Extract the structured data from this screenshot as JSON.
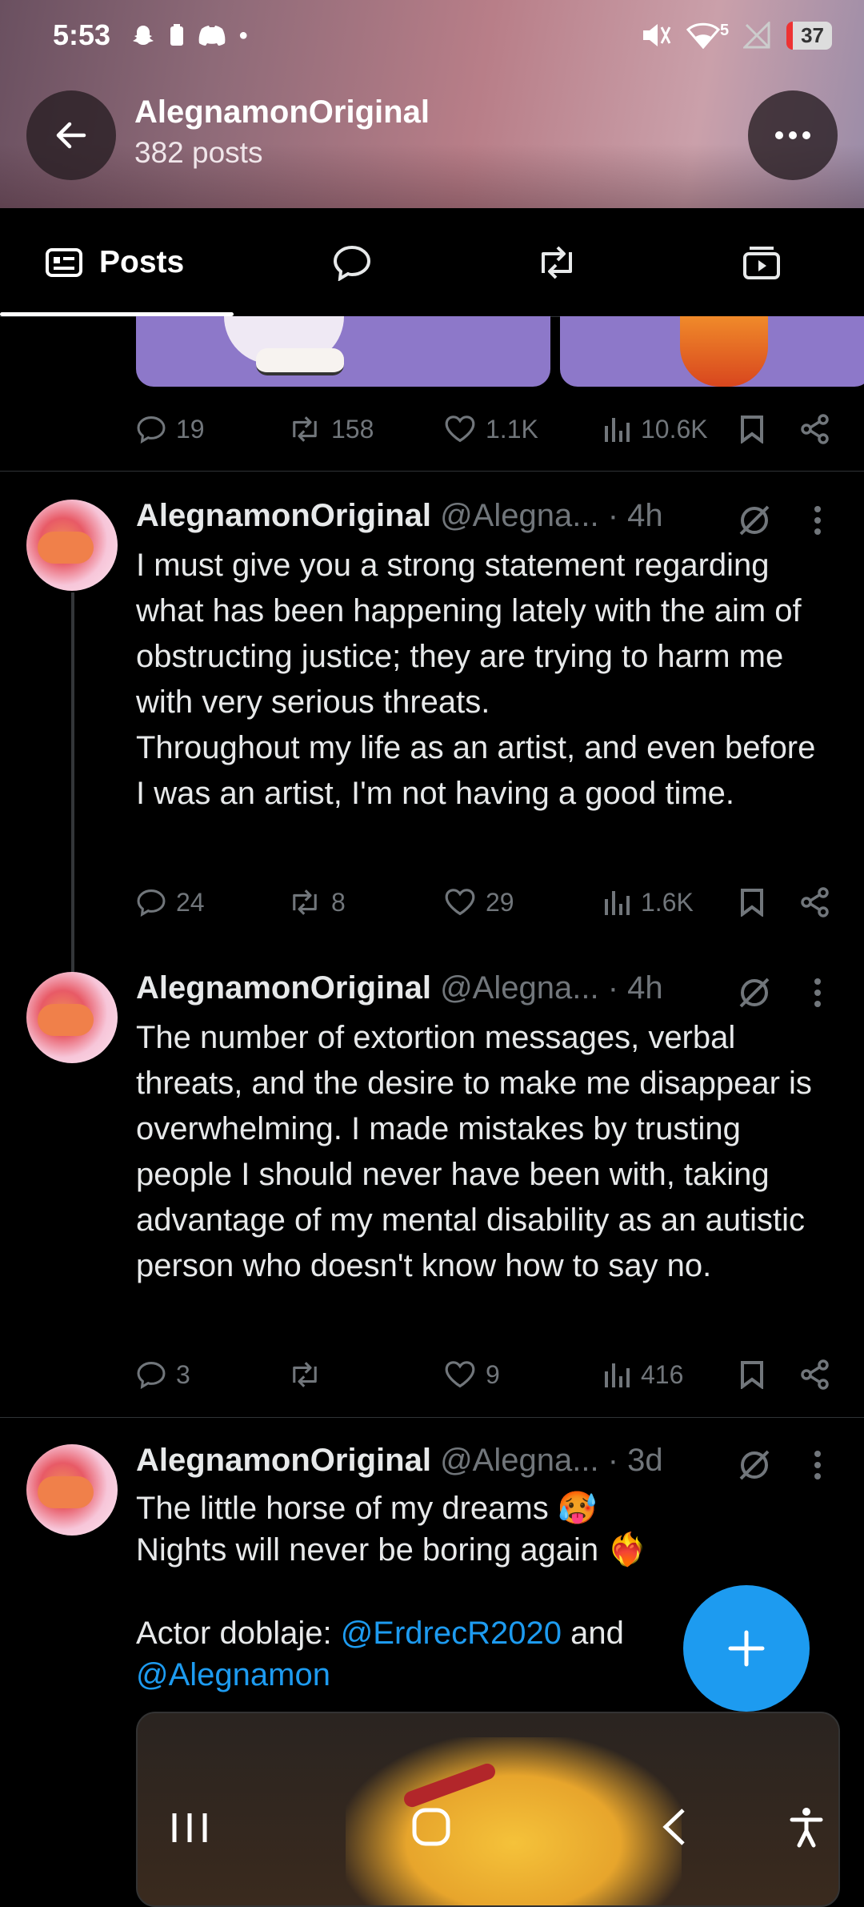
{
  "status_bar": {
    "time": "5:53",
    "signal_superscript": "5",
    "battery": "37"
  },
  "profile_header": {
    "name": "AlegnamonOriginal",
    "posts_count": "382 posts"
  },
  "tabs": [
    {
      "label": "Posts",
      "icon": "posts-icon"
    },
    {
      "icon": "reply-icon"
    },
    {
      "icon": "repost-icon"
    },
    {
      "icon": "media-icon"
    }
  ],
  "prev_post": {
    "replies": "19",
    "reposts": "158",
    "likes": "1.1K",
    "views": "10.6K"
  },
  "posts": [
    {
      "author": "AlegnamonOriginal",
      "handle": "@Alegna...",
      "time": "· 4h",
      "text": "I must give you a strong statement regarding what has been happening lately with the aim of obstructing justice; they are trying to harm me with very serious threats.\nThroughout my life as an artist, and even before I was an artist, I'm not having a good time.",
      "replies": "24",
      "reposts": "8",
      "likes": "29",
      "views": "1.6K"
    },
    {
      "author": "AlegnamonOriginal",
      "handle": "@Alegna...",
      "time": "· 4h",
      "text": "The number of extortion messages, verbal threats, and the desire to make me disappear is overwhelming. I made mistakes by trusting people I should never have been with, taking advantage of my mental disability as an autistic person who doesn't know how to say no.",
      "replies": "3",
      "reposts": "",
      "likes": "9",
      "views": "416"
    },
    {
      "author": "AlegnamonOriginal",
      "handle": "@Alegna...",
      "time": "· 3d",
      "line1": "The little horse of my dreams 🥵",
      "line2": "Nights will never be boring again ❤️‍🔥",
      "prefix": "Actor doblaje: ",
      "mention1": "@ErdrecR2020",
      "mid": " and",
      "mention2": "@Alegnamon"
    }
  ]
}
